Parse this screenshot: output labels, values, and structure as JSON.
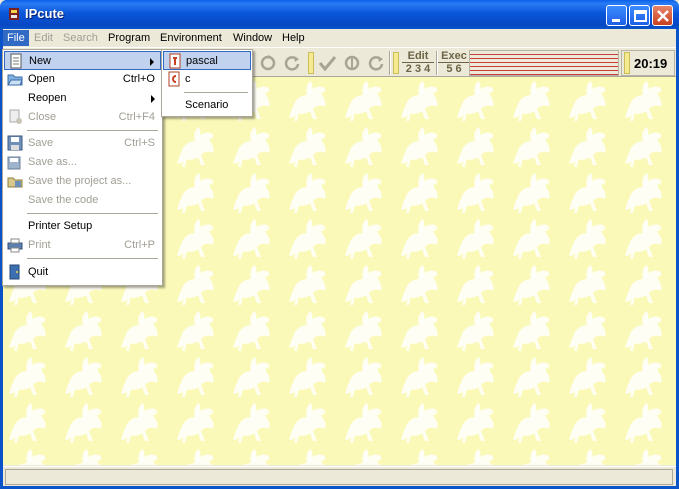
{
  "window": {
    "title": "IPcute"
  },
  "menubar": [
    {
      "label": "File",
      "state": "active"
    },
    {
      "label": "Edit",
      "state": "disabled"
    },
    {
      "label": "Search",
      "state": "disabled"
    },
    {
      "label": "Program",
      "state": "normal"
    },
    {
      "label": "Environment",
      "state": "normal"
    },
    {
      "label": "Window",
      "state": "normal"
    },
    {
      "label": "Help",
      "state": "normal"
    }
  ],
  "toolbar": {
    "edit_label": "Edit",
    "edit_numbers": "2 3 4",
    "exec_label": "Exec",
    "exec_numbers": "5 6",
    "clock": "20:19"
  },
  "file_menu": {
    "items": [
      {
        "label": "New",
        "shortcut": "",
        "submenu": true,
        "disabled": false,
        "icon": "new-document-icon"
      },
      {
        "label": "Open",
        "shortcut": "Ctrl+O",
        "disabled": false,
        "icon": "open-folder-icon"
      },
      {
        "label": "Reopen",
        "shortcut": "",
        "submenu": true,
        "disabled": false,
        "icon": ""
      },
      {
        "label": "Close",
        "shortcut": "Ctrl+F4",
        "disabled": true,
        "icon": "close-document-icon"
      },
      {
        "label": "Save",
        "shortcut": "Ctrl+S",
        "disabled": true,
        "icon": "floppy-disk-icon"
      },
      {
        "label": "Save as...",
        "shortcut": "",
        "disabled": true,
        "icon": "save-as-icon"
      },
      {
        "label": "Save the project as...",
        "shortcut": "",
        "disabled": true,
        "icon": "save-project-icon"
      },
      {
        "label": "Save the code",
        "shortcut": "",
        "disabled": true,
        "icon": ""
      },
      {
        "label": "Printer Setup",
        "shortcut": "",
        "disabled": false,
        "icon": ""
      },
      {
        "label": "Print",
        "shortcut": "Ctrl+P",
        "disabled": true,
        "icon": "printer-icon"
      },
      {
        "label": "Quit",
        "shortcut": "",
        "disabled": false,
        "icon": "quit-door-icon"
      }
    ]
  },
  "new_submenu": {
    "items": [
      {
        "label": "pascal",
        "icon": "pascal-file-icon"
      },
      {
        "label": "c",
        "icon": "c-file-icon"
      },
      {
        "label": "Scenario",
        "icon": ""
      }
    ]
  },
  "colors": {
    "workspace_bg": "#FBF9B8",
    "titlebar": "#0A53C9",
    "highlight": "#316AC5"
  }
}
